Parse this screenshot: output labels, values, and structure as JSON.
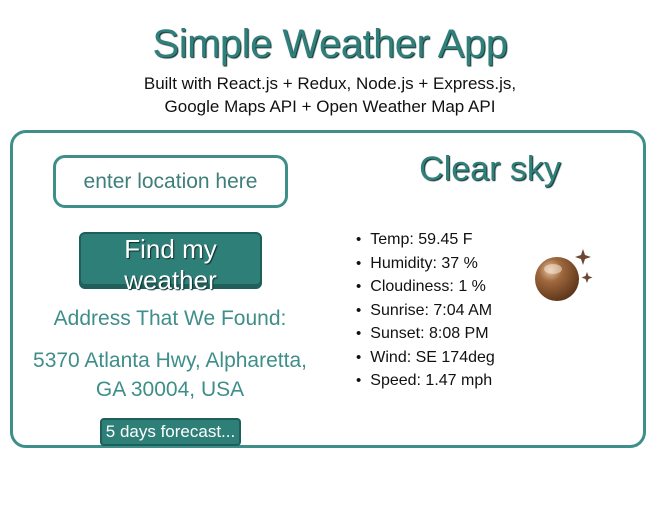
{
  "header": {
    "title": "Simple Weather App",
    "subtitle_line1": "Built with React.js + Redux, Node.js + Express.js,",
    "subtitle_line2": "Google Maps API + Open Weather Map API"
  },
  "search": {
    "placeholder": "enter location here",
    "value": "",
    "button_label": "Find my weather"
  },
  "address": {
    "label": "Address That We Found:",
    "value": "5370 Atlanta Hwy, Alpharetta, GA 30004, USA"
  },
  "forecast_button": "5 days forecast...",
  "weather": {
    "condition": "Clear sky",
    "icon": "clear-night-moon-icon",
    "details": [
      "Temp: 59.45 F",
      "Humidity: 37 %",
      "Cloudiness: 1 %",
      "Sunrise: 7:04 AM",
      "Sunset: 8:08 PM",
      "Wind: SE 174deg",
      "Speed: 1.47 mph"
    ]
  },
  "colors": {
    "accent": "#3e8e89",
    "button": "#2f7f79",
    "text": "#111111"
  }
}
